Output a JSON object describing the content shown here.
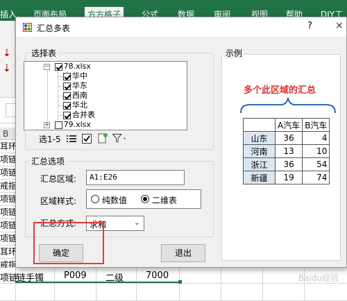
{
  "ribbon": {
    "tabs": [
      "插入",
      "页面布局",
      "方方格子",
      "公式",
      "数据",
      "审阅",
      "视图",
      "帮助",
      "DIY工"
    ],
    "active_tab": "方方格子"
  },
  "sheet": {
    "column_header": "B",
    "left_cells": [
      "耳环",
      "项链",
      "项链",
      "戒指",
      "项链",
      "项链",
      "项链",
      "项链",
      "耳环",
      "戒指",
      "项链"
    ],
    "bottom_row": [
      "链手镯",
      "P009",
      "二级",
      "7000"
    ],
    "watermark": "Baidu经验"
  },
  "dialog": {
    "title": "汇总多表",
    "help": "?",
    "close": "×",
    "select_group": {
      "label": "选择表",
      "tree": [
        {
          "label": "78.xlsx",
          "expanded": true,
          "checked": true,
          "children": [
            "华中",
            "华东",
            "西南",
            "华北",
            "合并表"
          ]
        },
        {
          "label": "79.xlsx",
          "expanded": false,
          "checked": false
        }
      ],
      "toolbar_label": "选1-5"
    },
    "options_group": {
      "label": "汇总选项",
      "range_label": "汇总区域:",
      "range_value": "A1:E26",
      "style_label": "区域样式:",
      "style_option1": "纯数值",
      "style_option2": "二维表",
      "style_selected": "二维表",
      "method_label": "汇总方式:",
      "method_value": "求和"
    },
    "ok_button": "确定",
    "exit_button": "退出",
    "example": {
      "label": "示例",
      "title": "多个此区域的汇总",
      "headers": [
        "",
        "A汽车",
        "B汽车"
      ],
      "rows": [
        [
          "山东",
          "36",
          "4"
        ],
        [
          "河南",
          "13",
          "10"
        ],
        [
          "浙江",
          "36",
          "54"
        ],
        [
          "新疆",
          "19",
          "74"
        ]
      ]
    }
  }
}
